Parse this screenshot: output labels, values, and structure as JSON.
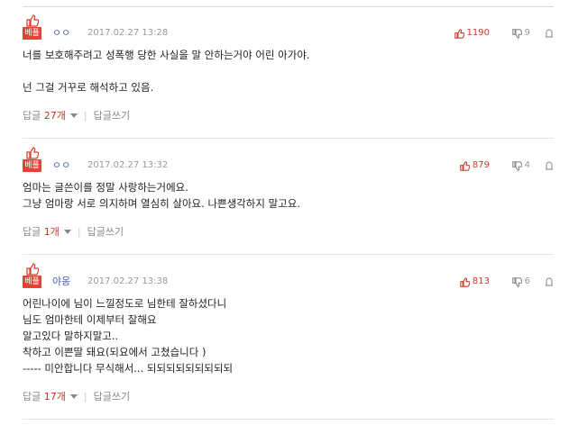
{
  "comments": [
    {
      "best": "베플",
      "nick": "ㅇㅇ",
      "date": "2017.02.27 13:28",
      "likes": "1190",
      "dislikes": "9",
      "lines": [
        "너를 보호해주려고 성폭행 당한 사실을 말 안하는거야 어린 아가야.",
        "",
        "넌 그걸 거꾸로 해석하고 있음."
      ],
      "reply_prefix": "답글 ",
      "reply_count": "27개",
      "write_reply": "답글쓰기"
    },
    {
      "best": "베플",
      "nick": "ㅇㅇ",
      "date": "2017.02.27 13:32",
      "likes": "879",
      "dislikes": "4",
      "lines": [
        "엄마는 글쓴이를 정말 사랑하는거에요.",
        "그냥 엄마랑 서로 의지하며 열심히 살아요. 나쁜생각하지 말고요."
      ],
      "reply_prefix": "답글 ",
      "reply_count": "1개",
      "write_reply": "답글쓰기"
    },
    {
      "best": "베플",
      "nick": "야옹",
      "date": "2017.02.27 13:38",
      "likes": "813",
      "dislikes": "6",
      "lines": [
        "어린나이에 님이 느낄정도로 님한테 잘하셨다니",
        "님도 엄마한테 이제부터 잘해요",
        "알고있다 말하지말고..",
        "착하고 이쁜딸 돼요(되요에서 고쳤습니다 )",
        "----- 미안합니다 무식해서... 되되되되되되되되되"
      ],
      "reply_prefix": "답글 ",
      "reply_count": "17개",
      "write_reply": "답글쓰기"
    }
  ],
  "icons": {
    "best": "thumbs-up-icon",
    "like": "thumbs-up-icon",
    "dislike": "thumbs-down-icon",
    "report": "report-icon",
    "reply_toggle": "caret-down-icon"
  },
  "colors": {
    "best_badge": "#e34235",
    "nick": "#4d64b4",
    "likes": "#d33a2c",
    "reply_count": "#c0392b"
  }
}
